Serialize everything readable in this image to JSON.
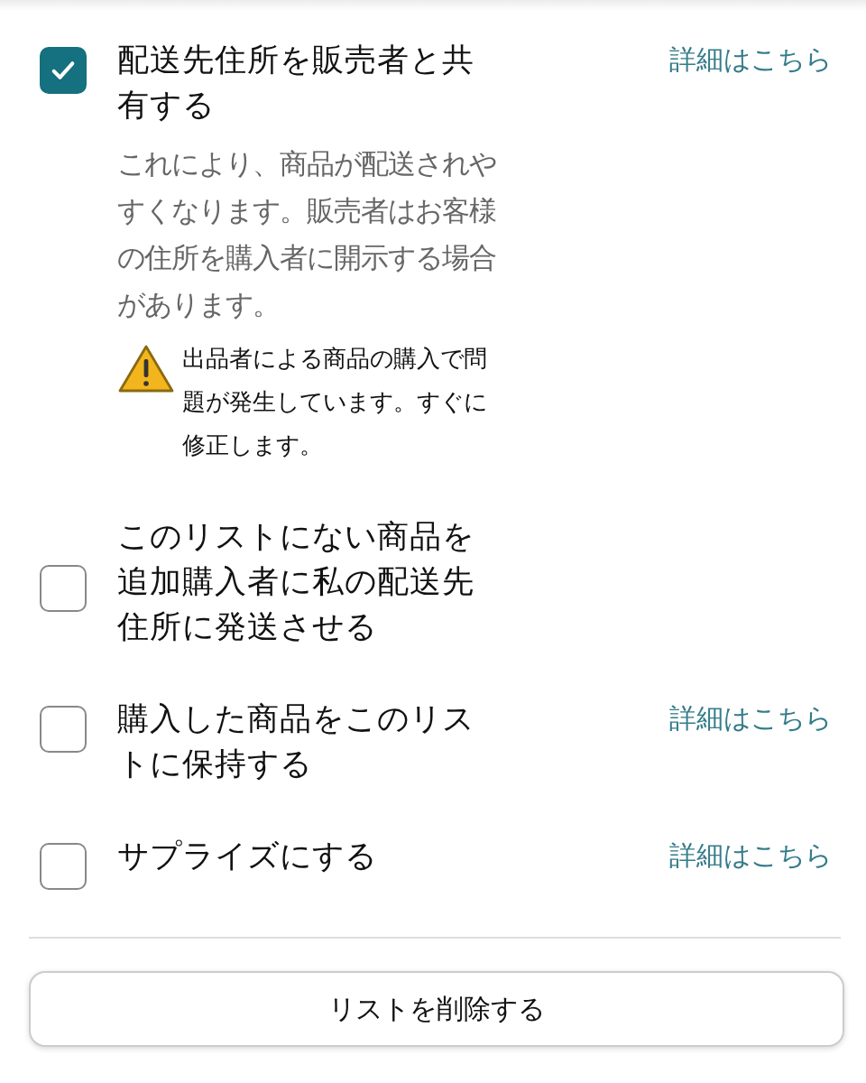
{
  "options": [
    {
      "label": "配送先住所を販売者と共有する",
      "checked": true,
      "link": "詳細はこちら",
      "description": "これにより、商品が配送されやすくなります。販売者はお客様の住所を購入者に開示する場合があります。",
      "warning": "出品者による商品の購入で問題が発生しています。すぐに修正します。"
    },
    {
      "label": "このリストにない商品を追加購入者に私の配送先住所に発送させる",
      "checked": false
    },
    {
      "label": "購入した商品をこのリストに保持する",
      "checked": false,
      "link": "詳細はこちら"
    },
    {
      "label": "サプライズにする",
      "checked": false,
      "link": "詳細はこちら"
    }
  ],
  "delete_button": "リストを削除する"
}
